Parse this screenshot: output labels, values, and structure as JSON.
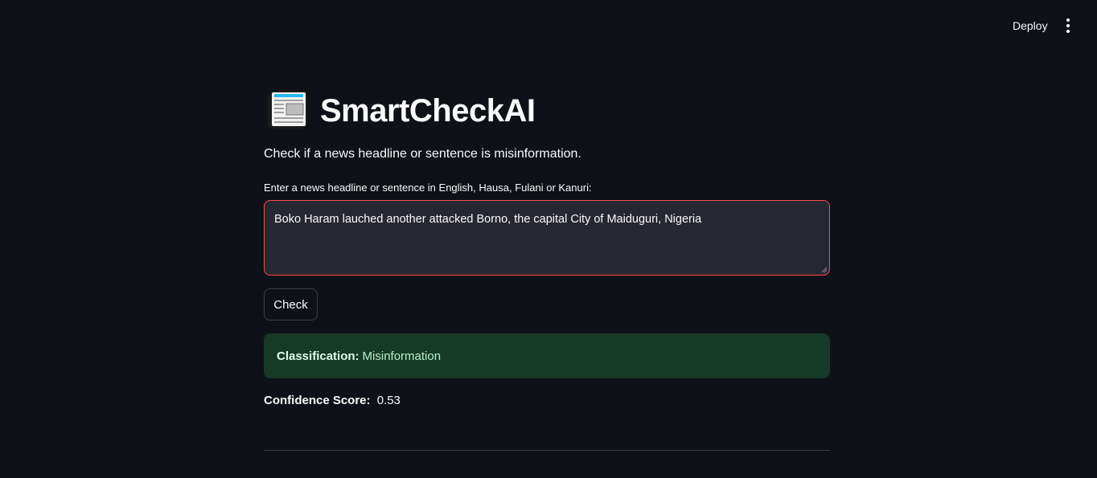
{
  "header": {
    "deploy_label": "Deploy",
    "menu_icon": "kebab-menu-icon"
  },
  "app": {
    "icon": "newspaper-icon",
    "title": "SmartCheckAI",
    "subtitle": "Check if a news headline or sentence is misinformation."
  },
  "input": {
    "label": "Enter a news headline or sentence in English, Hausa, Fulani or Kanuri:",
    "value": "Boko Haram lauched another attacked Borno, the capital City of Maiduguri, Nigeria"
  },
  "check_button": {
    "label": "Check"
  },
  "result": {
    "classification_label": "Classification:",
    "classification_value": "Misinformation",
    "confidence_label": "Confidence Score:",
    "confidence_value": "0.53"
  },
  "colors": {
    "background": "#0e1117",
    "input_border_focus": "#ff4b4b",
    "success_bg": "#173928",
    "text": "#fafafa"
  }
}
